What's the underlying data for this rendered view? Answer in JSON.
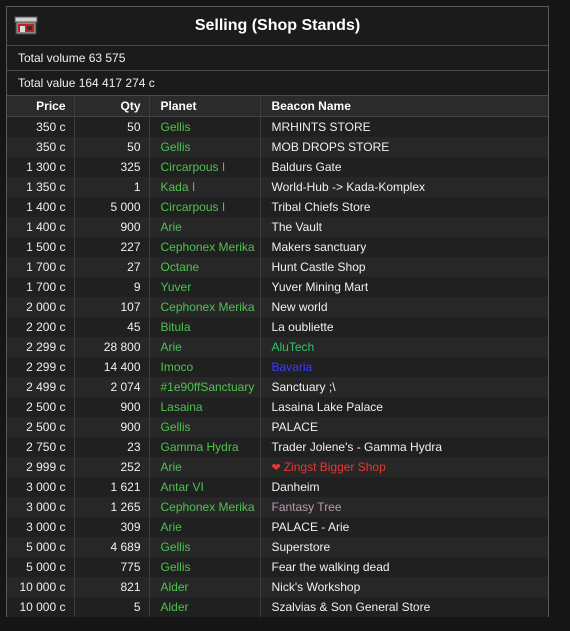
{
  "window": {
    "title": "Selling (Shop Stands)"
  },
  "summary": {
    "volume": "Total volume 63 575",
    "value": "Total value 164 417 274 c"
  },
  "columns": {
    "price": "Price",
    "qty": "Qty",
    "planet": "Planet",
    "beacon": "Beacon Name"
  },
  "colors": {
    "planet_green": "#4fc24f",
    "default_text": "#f0f0f0"
  },
  "rows": [
    {
      "price": "350 c",
      "qty": "50",
      "planet": "Gellis",
      "beacon": "MRHINTS STORE",
      "beacon_color": "#f0f0f0"
    },
    {
      "price": "350 c",
      "qty": "50",
      "planet": "Gellis",
      "beacon": "MOB DROPS STORE",
      "beacon_color": "#f0f0f0"
    },
    {
      "price": "1 300 c",
      "qty": "325",
      "planet": "Circarpous I",
      "beacon": "Baldurs Gate",
      "beacon_color": "#f0f0f0"
    },
    {
      "price": "1 350 c",
      "qty": "1",
      "planet": "Kada I",
      "beacon": "World-Hub -> Kada-Komplex",
      "beacon_color": "#f0f0f0"
    },
    {
      "price": "1 400 c",
      "qty": "5 000",
      "planet": "Circarpous I",
      "beacon": "Tribal Chiefs Store",
      "beacon_color": "#f0f0f0"
    },
    {
      "price": "1 400 c",
      "qty": "900",
      "planet": "Arie",
      "beacon": "The Vault",
      "beacon_color": "#f0f0f0"
    },
    {
      "price": "1 500 c",
      "qty": "227",
      "planet": "Cephonex Merika",
      "beacon": "Makers sanctuary",
      "beacon_color": "#f0f0f0"
    },
    {
      "price": "1 700 c",
      "qty": "27",
      "planet": "Octane",
      "beacon": "Hunt Castle Shop",
      "beacon_color": "#f0f0f0"
    },
    {
      "price": "1 700 c",
      "qty": "9",
      "planet": "Yuver",
      "beacon": "Yuver Mining Mart",
      "beacon_color": "#f0f0f0"
    },
    {
      "price": "2 000 c",
      "qty": "107",
      "planet": "Cephonex Merika",
      "beacon": "New world",
      "beacon_color": "#f0f0f0"
    },
    {
      "price": "2 200 c",
      "qty": "45",
      "planet": "Bitula",
      "beacon": "La oubliette",
      "beacon_color": "#f0f0f0"
    },
    {
      "price": "2 299 c",
      "qty": "28 800",
      "planet": "Arie",
      "beacon": "AluTech",
      "beacon_color": "#2ec46a"
    },
    {
      "price": "2 299 c",
      "qty": "14 400",
      "planet": "Imoco",
      "beacon": "Bavaria",
      "beacon_color": "#3b3bff"
    },
    {
      "price": "2 499 c",
      "qty": "2 074",
      "planet": "#1e90ffSanctuary",
      "beacon": "Sanctuary ;\\",
      "beacon_color": "#f0f0f0"
    },
    {
      "price": "2 500 c",
      "qty": "900",
      "planet": "Lasaina",
      "beacon": "Lasaina Lake Palace",
      "beacon_color": "#f0f0f0"
    },
    {
      "price": "2 500 c",
      "qty": "900",
      "planet": "Gellis",
      "beacon": "PALACE",
      "beacon_color": "#f0f0f0"
    },
    {
      "price": "2 750 c",
      "qty": "23",
      "planet": "Gamma Hydra",
      "beacon": "Trader Jolene's - Gamma Hydra",
      "beacon_color": "#f0f0f0"
    },
    {
      "price": "2 999 c",
      "qty": "252",
      "planet": "Arie",
      "beacon": "Zingst Bigger Shop",
      "beacon_color": "#e53935",
      "heart": true
    },
    {
      "price": "3 000 c",
      "qty": "1 621",
      "planet": "Antar VI",
      "beacon": "Danheim",
      "beacon_color": "#f0f0f0"
    },
    {
      "price": "3 000 c",
      "qty": "1 265",
      "planet": "Cephonex Merika",
      "beacon": "Fantasy Tree",
      "beacon_color": "#b99ab0"
    },
    {
      "price": "3 000 c",
      "qty": "309",
      "planet": "Arie",
      "beacon": "PALACE - Arie",
      "beacon_color": "#f0f0f0"
    },
    {
      "price": "5 000 c",
      "qty": "4 689",
      "planet": "Gellis",
      "beacon": "Superstore",
      "beacon_color": "#f0f0f0"
    },
    {
      "price": "5 000 c",
      "qty": "775",
      "planet": "Gellis",
      "beacon": "Fear the walking dead",
      "beacon_color": "#f0f0f0"
    },
    {
      "price": "10 000 c",
      "qty": "821",
      "planet": "Alder",
      "beacon": "Nick's Workshop",
      "beacon_color": "#f0f0f0"
    },
    {
      "price": "10 000 c",
      "qty": "5",
      "planet": "Alder",
      "beacon": "Szalvias & Son General Store",
      "beacon_color": "#f0f0f0"
    }
  ]
}
